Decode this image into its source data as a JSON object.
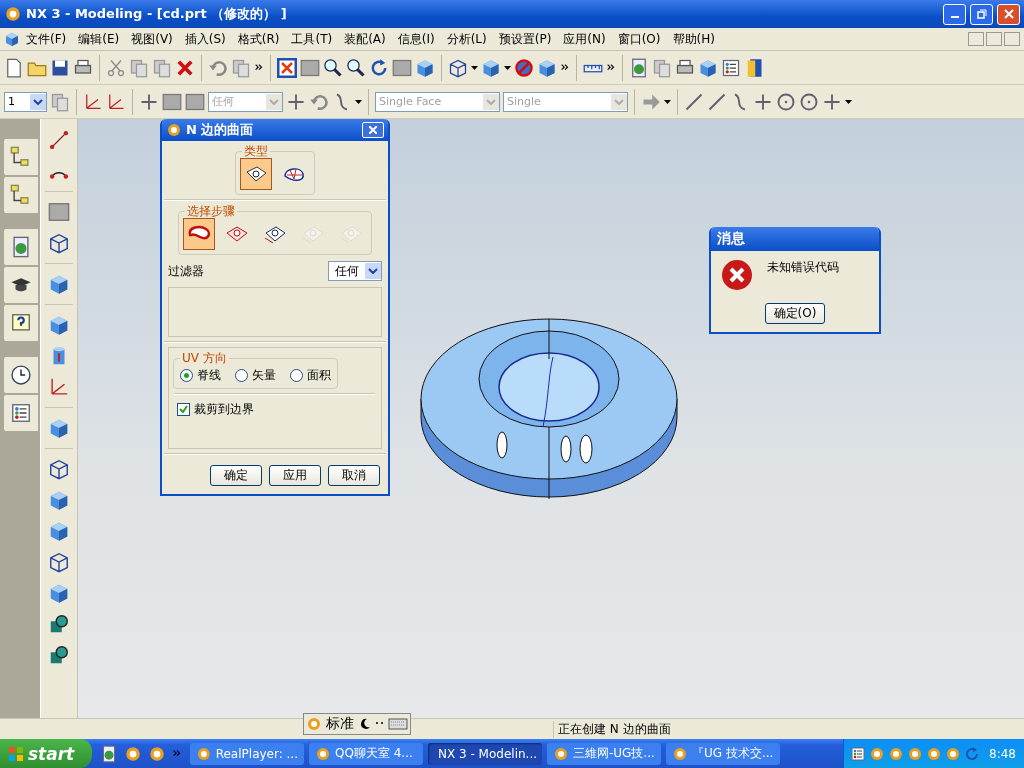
{
  "window": {
    "title": "NX 3 - Modeling - [cd.prt （修改的） ]"
  },
  "menu": [
    "文件(F)",
    "编辑(E)",
    "视图(V)",
    "插入(S)",
    "格式(R)",
    "工具(T)",
    "装配(A)",
    "信息(I)",
    "分析(L)",
    "预设置(P)",
    "应用(N)",
    "窗口(O)",
    "帮助(H)"
  ],
  "toolbar": {
    "layer": "1",
    "fields": [
      {
        "value": "任何",
        "disabled": true
      },
      {
        "value": "Single Face",
        "disabled": true
      },
      {
        "value": "Single",
        "disabled": true
      }
    ]
  },
  "dialog": {
    "title": "N 边的曲面",
    "type_label": "类型",
    "types": [
      {
        "selected": true
      },
      {
        "selected": false
      }
    ],
    "steps_label": "选择步骤",
    "steps": [
      {
        "selected": true,
        "disabled": false
      },
      {
        "selected": false,
        "disabled": false
      },
      {
        "selected": false,
        "disabled": false
      },
      {
        "selected": false,
        "disabled": true
      },
      {
        "selected": false,
        "disabled": true
      }
    ],
    "filter_label": "过滤器",
    "filter_value": "任何",
    "uv_label": "UV 方向",
    "uv_options": [
      {
        "label": "脊线",
        "selected": true
      },
      {
        "label": "矢量",
        "selected": false
      },
      {
        "label": "面积",
        "selected": false
      }
    ],
    "trim": {
      "label": "裁剪到边界",
      "checked": true
    },
    "buttons": [
      "确定",
      "应用",
      "取消"
    ]
  },
  "message": {
    "title": "消息",
    "text": "未知错误代码",
    "button": "确定(O)"
  },
  "status_bar": {
    "ime": "标准",
    "text": "正在创建 N 边的曲面"
  },
  "taskbar": {
    "start": "start",
    "tasks": [
      {
        "label": "RealPlayer: ...",
        "selected": false
      },
      {
        "label": "QQ聊天室  4...",
        "selected": false
      },
      {
        "label": "NX 3 - Modelin...",
        "selected": true
      },
      {
        "label": "三維网-UG技...",
        "selected": false
      },
      {
        "label": "『UG 技术交...",
        "selected": false
      }
    ],
    "clock": "8:48"
  }
}
